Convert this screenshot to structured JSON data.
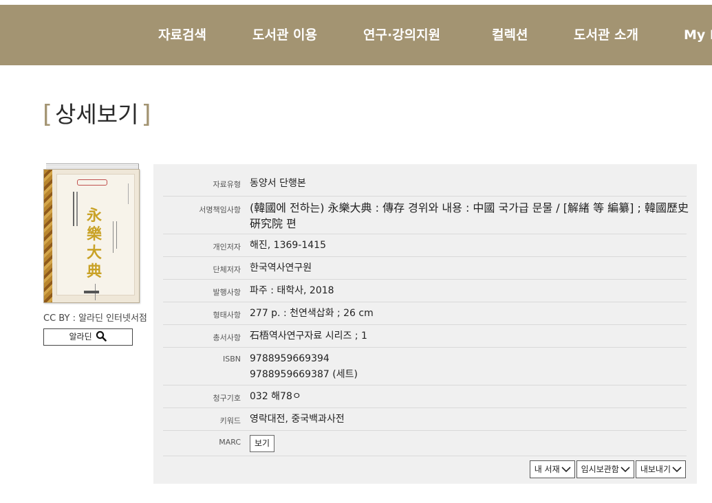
{
  "nav": {
    "items": [
      "자료검색",
      "도서관 이용",
      "연구·강의지원",
      "컬렉션",
      "도서관 소개",
      "My L"
    ]
  },
  "page": {
    "title": "상세보기"
  },
  "cover": {
    "kanji": "永樂大典",
    "credit": "CC BY : 알라딘 인터넷서점",
    "aladin_button": "알라딘",
    "icon": "search-icon"
  },
  "details": [
    {
      "label": "자료유형",
      "value": "동양서 단행본"
    },
    {
      "label": "서명책임사항",
      "value": "(韓國에 전하는) 永樂大典 : 傳存 경위와 내용 : 中國 국가급 문물 / [解緖 等 編纂] ; 韓國歷史硏究院 편"
    },
    {
      "label": "개인저자",
      "value": "해진, 1369-1415"
    },
    {
      "label": "단체저자",
      "value": "한국역사연구원"
    },
    {
      "label": "발행사항",
      "value": "파주 : 태학사, 2018"
    },
    {
      "label": "형태사항",
      "value": "277 p. : 천연색삽화 ; 26 cm"
    },
    {
      "label": "총서사항",
      "value": "石梧역사연구자료 시리즈 ; 1"
    },
    {
      "label": "ISBN",
      "value": "9788959669394",
      "value2": "9788959669387 (세트)"
    },
    {
      "label": "청구기호",
      "value": "032 해78ㅇ"
    },
    {
      "label": "키워드",
      "value": "영락대전, 중국백과사전"
    },
    {
      "label": "MARC",
      "value": "보기"
    }
  ],
  "actions": [
    "내 서재",
    "임시보관함",
    "내보내기"
  ],
  "colors": {
    "brand": "#a39472",
    "panel": "#f0f0f0"
  }
}
